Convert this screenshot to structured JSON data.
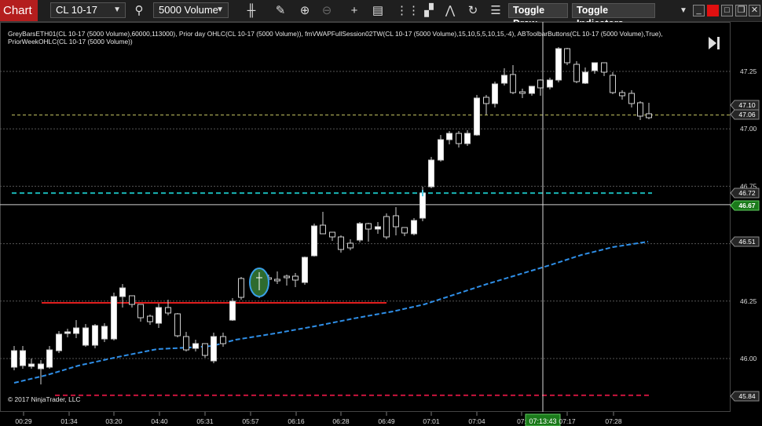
{
  "toolbar": {
    "chart_tab": "Chart",
    "instrument": "CL 10-17",
    "bar_type": "5000 Volume",
    "toggle_draw": "Toggle Draw",
    "toggle_indicators": "Toggle Indicators",
    "icons": [
      "search-icon",
      "bar-style-icon",
      "pencil-icon",
      "zoom-in-icon",
      "zoom-out-icon",
      "crosshair-icon",
      "data-box-icon",
      "indicators-icon",
      "strategies-icon",
      "drawing-tools-icon",
      "reload-icon",
      "properties-icon"
    ]
  },
  "chart": {
    "legend": "GreyBarsETH01(CL 10-17 (5000 Volume),60000,113000), Prior day OHLC(CL 10-17 (5000 Volume)), fmVWAPFullSession02TW(CL 10-17 (5000 Volume),15,10,5,5,10,15,-4), ABToolbarButtons(CL 10-17 (5000 Volume),True), PriorWeekOHLC(CL 10-17 (5000 Volume))",
    "copyright": "© 2017 NinjaTrader, LLC",
    "crosshair_time": "07:13:43",
    "colors": {
      "up": "#ffffff",
      "down": "#000000",
      "vwap": "#2f8fe8",
      "red_line": "#e01e1e",
      "cyan_line": "#19b4b4",
      "yellow_line": "#c8c864",
      "last_price": "#1b7a1b"
    }
  },
  "price_axis": {
    "ticks": [
      "47.25",
      "47.00",
      "46.75",
      "46.50",
      "46.25",
      "46.00"
    ],
    "markers": [
      {
        "label": "47.10",
        "style": "dark"
      },
      {
        "label": "47.06",
        "style": "dark"
      },
      {
        "label": "46.72",
        "style": "dark"
      },
      {
        "label": "46.67",
        "style": "green"
      },
      {
        "label": "46.51",
        "style": "dark"
      },
      {
        "label": "45.84",
        "style": "dark"
      }
    ]
  },
  "time_axis": {
    "ticks": [
      "00:29",
      "01:34",
      "03:20",
      "04:40",
      "05:31",
      "05:57",
      "06:16",
      "06:28",
      "06:49",
      "07:01",
      "07:04",
      "07:",
      "07:17",
      "07:28"
    ]
  }
}
